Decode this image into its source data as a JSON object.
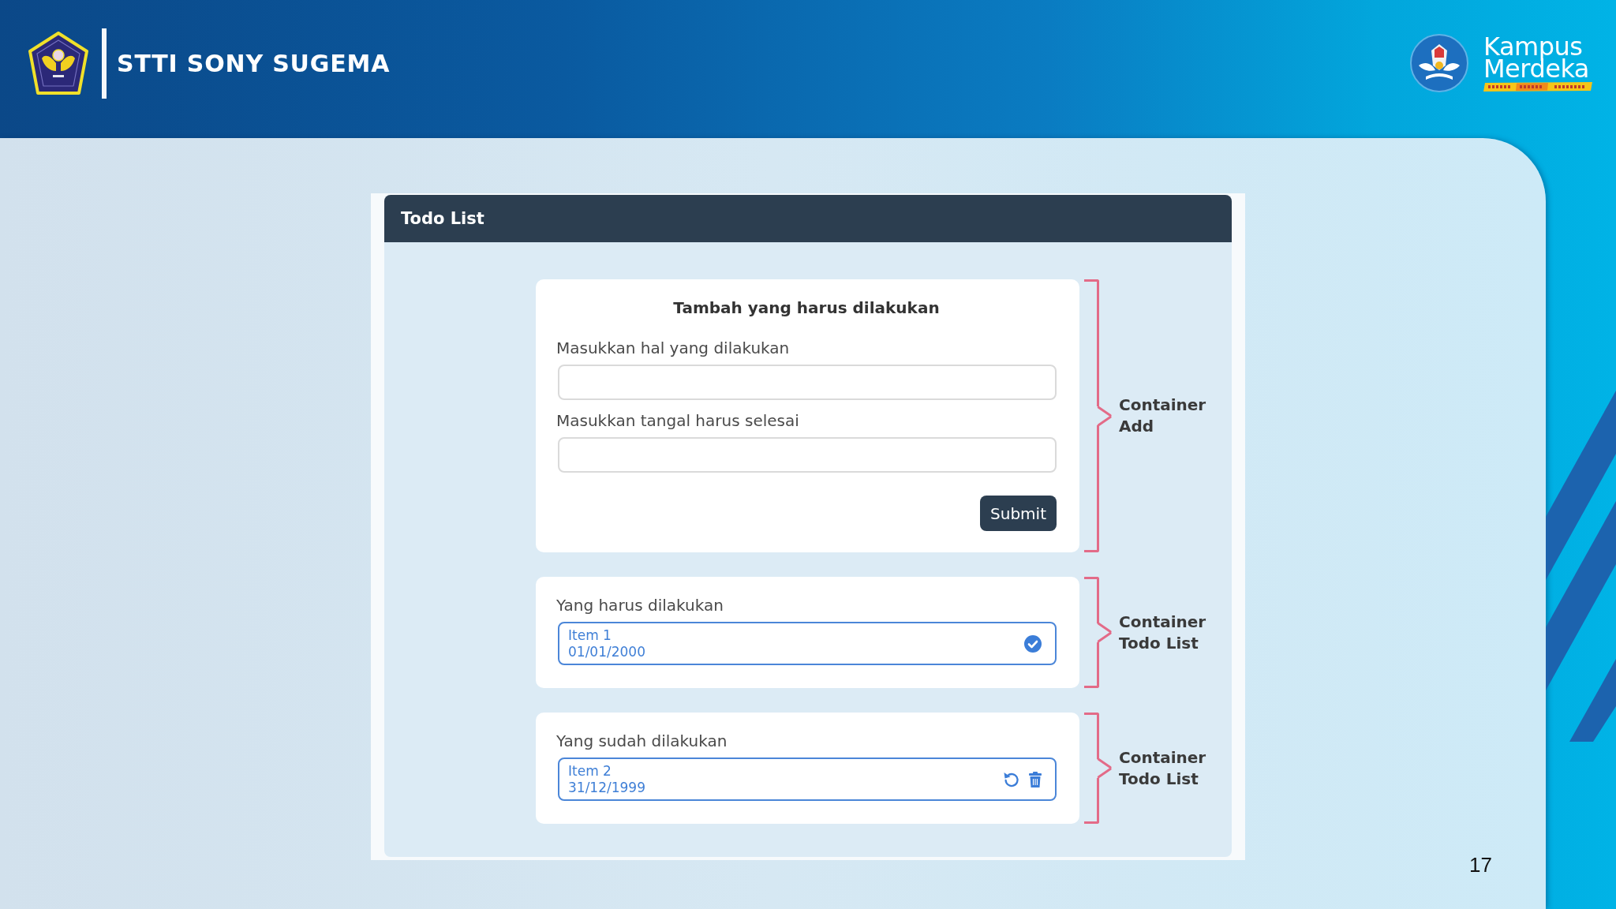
{
  "header": {
    "institution": "STTI SONY SUGEMA",
    "partner_logo": "Kampus Merdeka"
  },
  "todo_app": {
    "title": "Todo List",
    "add_form": {
      "title": "Tambah yang harus dilakukan",
      "fields": [
        {
          "label": "Masukkan hal yang dilakukan"
        },
        {
          "label": "Masukkan tangal harus selesai"
        }
      ],
      "submit_button": "Submit",
      "annotation": "Container Add"
    },
    "lists": [
      {
        "title": "Yang harus dilakukan",
        "annotation": "Container Todo List",
        "items": [
          {
            "name": "Item 1",
            "date": "01/01/2000",
            "done": false
          }
        ]
      },
      {
        "title": "Yang sudah dilakukan",
        "annotation": "Container Todo List",
        "items": [
          {
            "name": "Item 2",
            "date": "31/12/1999",
            "done": true
          }
        ]
      }
    ]
  },
  "page_number": "17"
}
